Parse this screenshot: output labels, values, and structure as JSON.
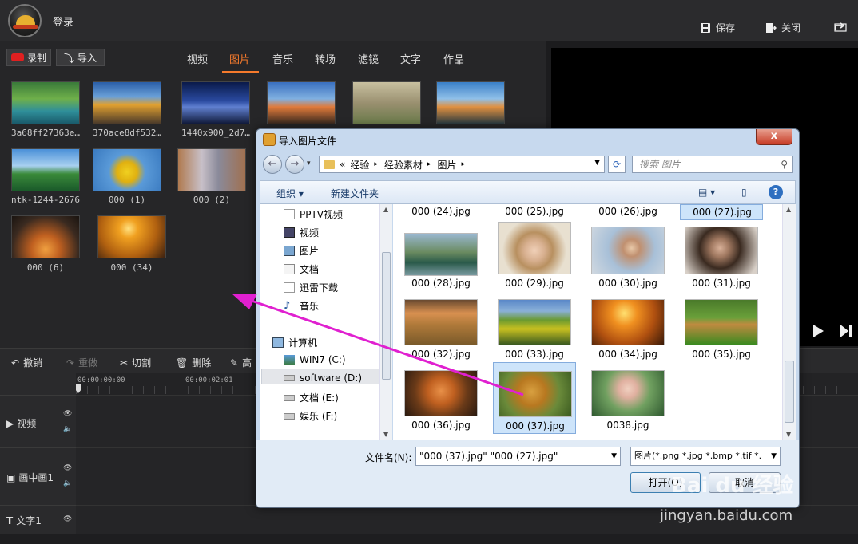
{
  "app": {
    "login": "登录",
    "save": "保存",
    "close": "关闭"
  },
  "media": {
    "record_label": "录制",
    "import_label": "导入",
    "tabs": [
      "视频",
      "图片",
      "音乐",
      "转场",
      "滤镜",
      "文字",
      "作品"
    ],
    "active_tab": "图片",
    "thumbnails": [
      {
        "label": "3a68ff27363e…"
      },
      {
        "label": "370ace8df532…"
      },
      {
        "label": "1440x900_2d7…"
      },
      {
        "label": ""
      },
      {
        "label": ""
      },
      {
        "label": ""
      },
      {
        "label": "ntk-1244-2676"
      },
      {
        "label": "000 (1)"
      },
      {
        "label": "000 (2)"
      },
      {
        "label": "000 (6)"
      },
      {
        "label": "000 (34)"
      }
    ]
  },
  "edit_tools": {
    "undo": "撤销",
    "redo": "重做",
    "cut": "切割",
    "delete": "删除",
    "highlight": "高"
  },
  "timeline": {
    "ruler": [
      "00:00:00:00",
      "00:00:02:01"
    ],
    "tracks": [
      "视频",
      "画中画1",
      "文字1"
    ]
  },
  "dialog": {
    "title": "导入图片文件",
    "close": "x",
    "breadcrumb": [
      "«",
      "经验",
      "经验素材",
      "图片"
    ],
    "search_placeholder": "搜索 图片",
    "organize": "组织 ▾",
    "new_folder": "新建文件夹",
    "nav": [
      "PPTV视频",
      "视频",
      "图片",
      "文档",
      "迅雷下载",
      "音乐",
      "计算机",
      "WIN7 (C:)",
      "software (D:)",
      "文档 (E:)",
      "娱乐 (F:)"
    ],
    "files": [
      "000 (24).jpg",
      "000 (25).jpg",
      "000 (26).jpg",
      "000 (27).jpg",
      "000 (28).jpg",
      "000 (29).jpg",
      "000 (30).jpg",
      "000 (31).jpg",
      "000 (32).jpg",
      "000 (33).jpg",
      "000 (34).jpg",
      "000 (35).jpg",
      "000 (36).jpg",
      "000 (37).jpg",
      "0038.jpg"
    ],
    "selected_files": [
      "000 (27).jpg",
      "000 (37).jpg"
    ],
    "filename_label": "文件名(N):",
    "filename_value": "\"000 (37).jpg\" \"000 (27).jpg\"",
    "filetype_value": "图片(*.png *.jpg *.bmp *.tif *.",
    "open_button": "打开(O)",
    "cancel_button": "取消"
  },
  "watermark": {
    "logo": "Bai du 经验",
    "url": "jingyan.baidu.com"
  },
  "colors": {
    "accent": "#f57a2c",
    "annotation_arrow": "#e020d0"
  }
}
